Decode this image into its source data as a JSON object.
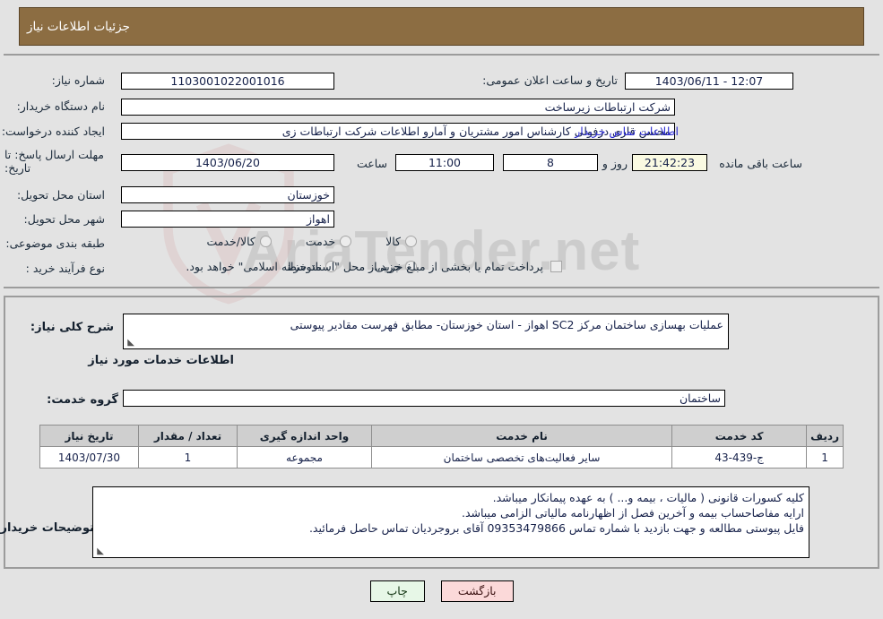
{
  "header": {
    "title": "جزئیات اطلاعات نیاز"
  },
  "watermark": {
    "text": "AriaTender.net"
  },
  "form": {
    "need_number_label": "شماره نیاز:",
    "need_number_value": "1103001022001016",
    "announce_datetime_label": "تاریخ و ساعت اعلان عمومی:",
    "announce_datetime_value": "1403/06/11 - 12:07",
    "buyer_org_label": "نام دستگاه خریدار:",
    "buyer_org_value": "شرکت ارتباطات زیرساخت",
    "creator_label": "ایجاد کننده درخواست:",
    "creator_value": "محسن قاری دزفولی کارشناس امور مشتریان و آمارو اطلاعات شرکت ارتباطات زی",
    "buyer_contact_link": "اطلاعات تماس خریدار",
    "deadline_label": "مهلت ارسال پاسخ: تا تاریخ:",
    "deadline_date": "1403/06/20",
    "deadline_time_label": "ساعت",
    "deadline_time": "11:00",
    "remaining_days": "8",
    "remaining_days_label": "روز و",
    "remaining_clock": "21:42:23",
    "remaining_suffix": "ساعت باقی مانده",
    "province_label": "استان محل تحویل:",
    "province_value": "خوزستان",
    "city_label": "شهر محل تحویل:",
    "city_value": "اهواز",
    "category_label": "طبقه بندی موضوعی:",
    "category_options": [
      {
        "label": "کالا",
        "checked": false
      },
      {
        "label": "خدمت",
        "checked": false
      },
      {
        "label": "کالا/خدمت",
        "checked": false
      }
    ],
    "process_label": "نوع فرآیند خرید :",
    "process_options": [
      {
        "label": "جزیی",
        "checked": false
      },
      {
        "label": "متوسط",
        "checked": false
      }
    ],
    "treasury_checkbox_label": "پرداخت تمام یا بخشی از مبلغ خرید،از محل \"اسناد خزانه اسلامی\" خواهد بود.",
    "treasury_checked": false
  },
  "description": {
    "label": "شرح کلی نیاز:",
    "value": "عملیات بهسازی ساختمان مرکز SC2 اهواز - استان خوزستان- مطابق فهرست مقادیر پیوستی"
  },
  "services_section": {
    "title": "اطلاعات خدمات مورد نیاز",
    "group_label": "گروه خدمت:",
    "group_value": "ساختمان"
  },
  "table": {
    "headers": [
      "ردیف",
      "کد خدمت",
      "نام خدمت",
      "واحد اندازه گیری",
      "تعداد / مقدار",
      "تاریخ نیاز"
    ],
    "rows": [
      {
        "index": "1",
        "code": "ج-439-43",
        "name": "سایر فعالیت‌های تخصصی ساختمان",
        "unit": "مجموعه",
        "qty": "1",
        "date": "1403/07/30"
      }
    ]
  },
  "buyer_notes": {
    "label": "توضیحات خریدار:",
    "lines": [
      "کلیه کسورات قانونی ( مالیات ، بیمه و... ) به عهده پیمانکار میباشد.",
      "ارایه مفاصاحساب بیمه و آخرین فصل از اظهارنامه مالیاتی الزامی میباشد.",
      "فایل پیوستی مطالعه و جهت بازدید با شماره تماس  09353479866  آقای بروجردیان تماس حاصل فرمائید."
    ]
  },
  "buttons": {
    "print": "چاپ",
    "back": "بازگشت"
  },
  "colors": {
    "header_brown": "#8c6d42",
    "page_bg": "#e3e3e3",
    "link_blue": "#2a2ad0",
    "table_header": "#cfcfcf",
    "print_btn": "#e7f7e7",
    "back_btn": "#fbd9d9",
    "countdown_bg": "#fafae2"
  }
}
